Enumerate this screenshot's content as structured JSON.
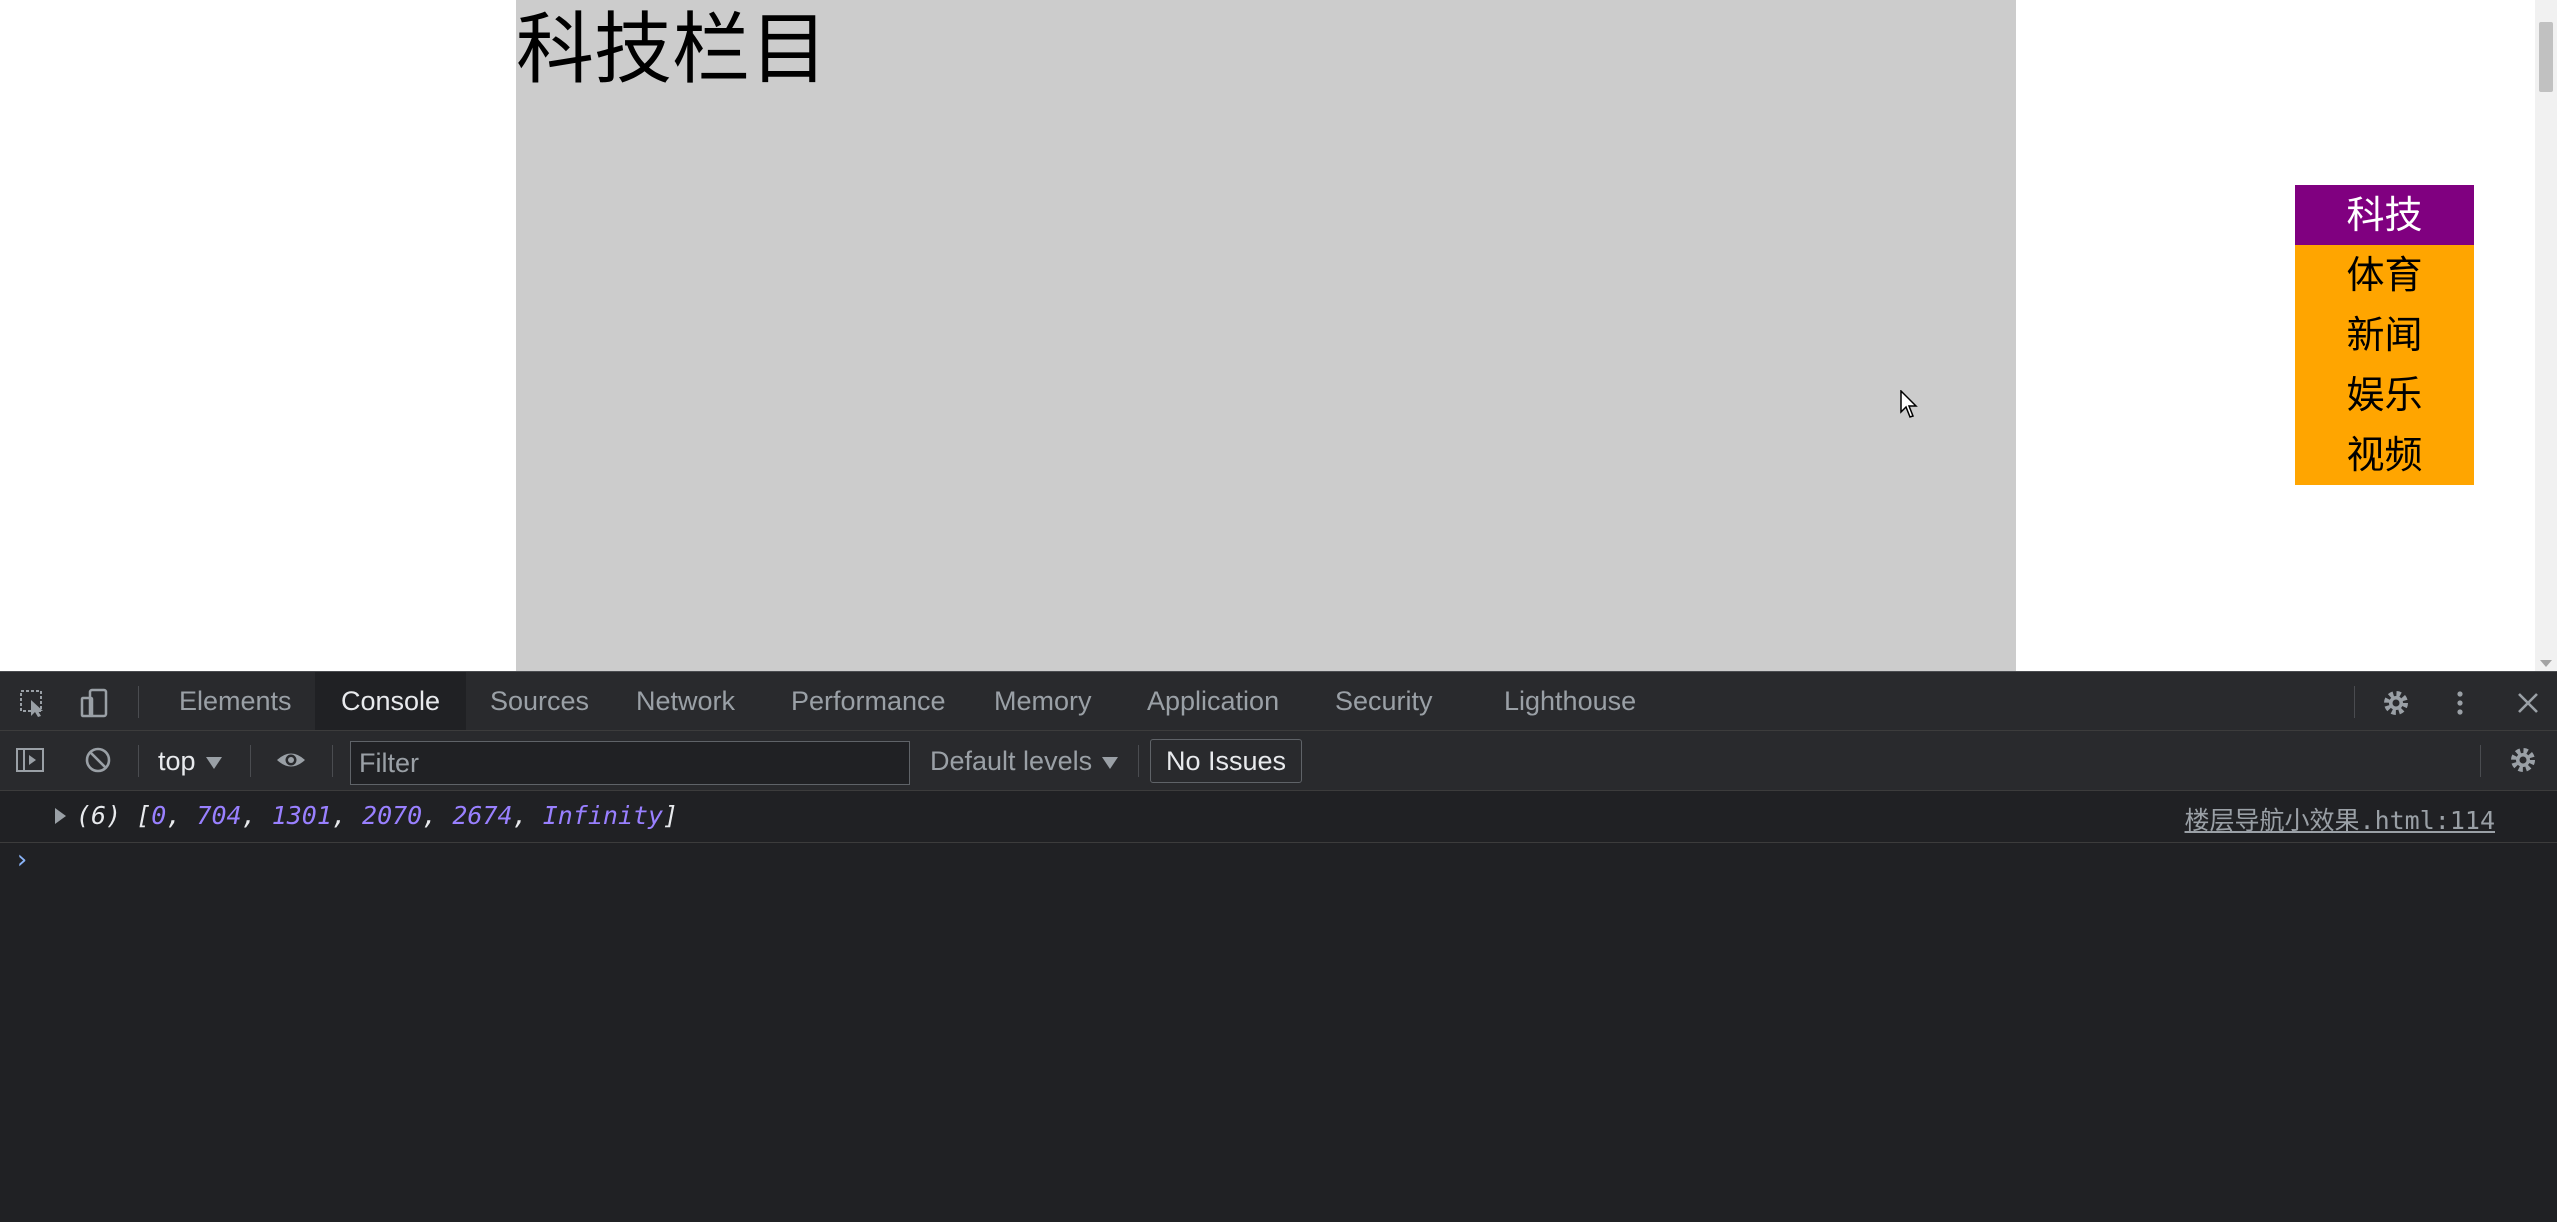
{
  "page": {
    "section_title": "科技栏目",
    "floor_nav": [
      {
        "label": "科技",
        "active": true
      },
      {
        "label": "体育",
        "active": false
      },
      {
        "label": "新闻",
        "active": false
      },
      {
        "label": "娱乐",
        "active": false
      },
      {
        "label": "视频",
        "active": false
      }
    ],
    "colors": {
      "section_bg": "#cccccc",
      "nav_bg": "#ffa500",
      "nav_active_bg": "#800080"
    }
  },
  "devtools": {
    "tabs": [
      "Elements",
      "Console",
      "Sources",
      "Network",
      "Performance",
      "Memory",
      "Application",
      "Security",
      "Lighthouse"
    ],
    "active_tab": "Console",
    "toolbar": {
      "context": "top",
      "filter_placeholder": "Filter",
      "filter_value": "",
      "levels": "Default levels",
      "issues": "No Issues"
    },
    "console": {
      "log_prefix": "(6) [",
      "log_values": [
        "0",
        "704",
        "1301",
        "2070",
        "2674",
        "Infinity"
      ],
      "log_suffix": "]",
      "source": "楼层导航小效果.html:114",
      "prompt": "›"
    },
    "icons": [
      "inspect-element-icon",
      "device-toolbar-icon",
      "settings-icon",
      "more-options-icon",
      "close-icon",
      "sidebar-toggle-icon",
      "clear-console-icon",
      "live-expression-eye-icon",
      "console-settings-icon"
    ]
  }
}
